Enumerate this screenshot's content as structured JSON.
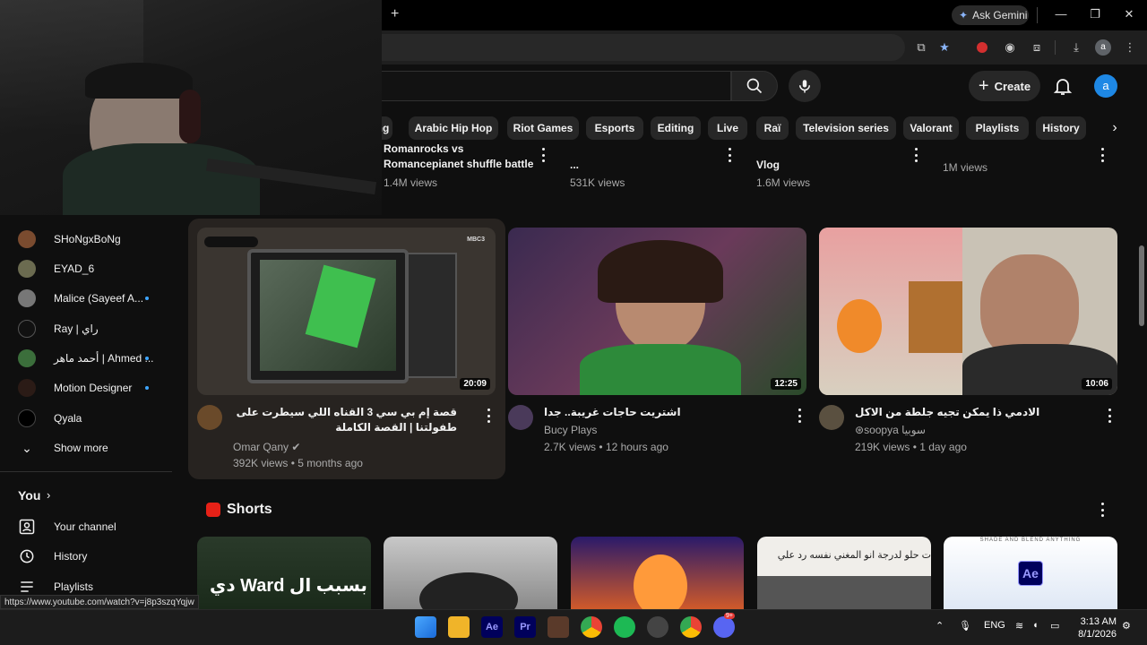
{
  "browser": {
    "new_tab": "+",
    "ask_gemini": "Ask Gemini",
    "profile_letter": "a",
    "status_url": "https://www.youtube.com/watch?v=j8p3szqYqjw"
  },
  "youtube": {
    "create_label": "Create",
    "avatar_letter": "a",
    "chips": [
      "ng",
      "Arabic Hip Hop",
      "Riot Games",
      "Esports",
      "Editing",
      "Live",
      "Raï",
      "Television series",
      "Valorant",
      "Playlists",
      "History"
    ],
    "top_row": [
      {
        "title": "Romanrocks vs Romancepianet shuffle battle",
        "meta": "1.4M views"
      },
      {
        "title": "...",
        "meta": "531K views"
      },
      {
        "title": "Vlog",
        "meta": "1.6M views"
      },
      {
        "title": "",
        "meta": "1M views"
      }
    ],
    "videos": [
      {
        "title": "قصة إم بي سي 3 القناه اللي سيطرت على طفولتنا | القصة الكاملة",
        "channel": "Omar Qany",
        "meta": "392K views • 5 months ago",
        "duration": "20:09",
        "thumb_badge": "MBC3"
      },
      {
        "title": "اشتريت حاجات غريبة.. جدا",
        "channel": "Bucy Plays",
        "meta": "2.7K views • 12 hours ago",
        "duration": "12:25"
      },
      {
        "title": "الادمي ذا يمكن تجيه جلطة من الاكل",
        "channel": "soopya سوبيا",
        "meta": "219K views • 1 day ago",
        "duration": "10:06"
      }
    ],
    "shorts_label": "Shorts",
    "shorts": [
      {
        "text": "بسبب ال Ward دي"
      },
      {
        "text": ""
      },
      {
        "text": ""
      },
      {
        "text": "ت حلو لدرجة انو المغني نفسه رد علي"
      },
      {
        "text": "SHADE AND BLEND ANYTHING",
        "badge": "Ae"
      }
    ]
  },
  "sidebar": {
    "subscriptions": [
      {
        "name": "SHoNgxBoNg",
        "color": "#7a4b2f",
        "dot": false
      },
      {
        "name": "EYAD_6",
        "color": "#6b6b50",
        "dot": false
      },
      {
        "name": "Malice (Sayeef A...",
        "color": "#777",
        "dot": true
      },
      {
        "name": "Ray | راي",
        "color": "#111",
        "dot": false
      },
      {
        "name": "أحمد ماهر | Ahmed ...",
        "color": "#3b6e3b",
        "dot": true
      },
      {
        "name": "Motion Designer",
        "color": "#2b1b16",
        "dot": true
      },
      {
        "name": "Qyala",
        "color": "#000",
        "dot": false
      }
    ],
    "show_more": "Show more",
    "you_label": "You",
    "you_links": [
      {
        "label": "Your channel",
        "icon": "channel-icon"
      },
      {
        "label": "History",
        "icon": "history-icon"
      },
      {
        "label": "Playlists",
        "icon": "playlists-icon"
      }
    ]
  },
  "taskbar": {
    "lang": "ENG",
    "time": "3:13 AM",
    "date": "8/1/2026",
    "apps": [
      "windows-start-icon",
      "file-explorer-icon",
      "after-effects-icon",
      "premiere-pro-icon",
      "app-icon",
      "chrome-icon",
      "app-green-icon",
      "app-icon",
      "chrome-icon",
      "discord-icon"
    ],
    "discord_badge": "9+"
  }
}
